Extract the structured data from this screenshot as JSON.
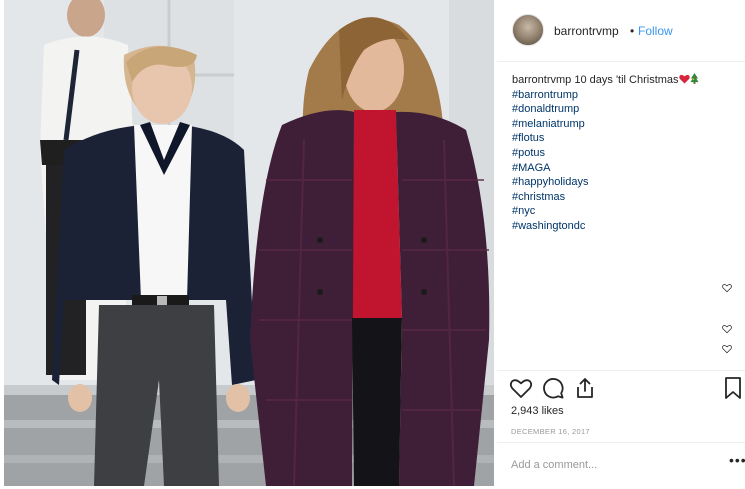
{
  "post": {
    "photo_icon": "photo-of-people-walking",
    "username": "barrontrvmp",
    "follow_label": "Follow",
    "separator": "•",
    "caption": {
      "owner": "barrontrvmp",
      "text": "10 days 'til Christmas",
      "emojis": [
        "red-heart-icon",
        "christmas-tree-icon"
      ],
      "hashtags": [
        "#barrontrump",
        "#donaldtrump",
        "#melaniatrump",
        "#flotus",
        "#potus",
        "#MAGA",
        "#happyholidays",
        "#christmas",
        "#nyc",
        "#washingtondc"
      ]
    },
    "comment_like_icons": [
      "heart-outline-icon",
      "heart-outline-icon",
      "heart-outline-icon"
    ],
    "actions": {
      "like_icon": "heart-outline-icon",
      "comment_icon": "comment-bubble-icon",
      "share_icon": "share-icon",
      "save_icon": "bookmark-icon"
    },
    "likes_text": "2,943 likes",
    "date": "DECEMBER 16, 2017",
    "comment_placeholder": "Add a comment...",
    "more_label": "•••"
  },
  "colors": {
    "link_blue": "#3897f0",
    "hashtag": "#003569",
    "text": "#262626",
    "muted": "#999999",
    "heart_emoji": "#d8263a",
    "tree_emoji": "#2f8a3a"
  }
}
